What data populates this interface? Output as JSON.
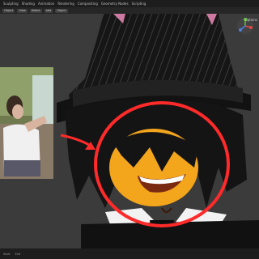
{
  "app": {
    "workspace_tabs": [
      "Sculpting",
      "Shading",
      "Animation",
      "Rendering",
      "Compositing",
      "Geometry Nodes",
      "Scripting"
    ]
  },
  "toolbar": {
    "mode_label": "Object",
    "view_label": "View",
    "select_label": "Select",
    "add_label": "Add",
    "object_label": "Object"
  },
  "viewport": {
    "options_label": "Options"
  },
  "status": {
    "start_label": "Start",
    "end_label": "End"
  },
  "colors": {
    "annotation_red": "#ff2a2a",
    "face_yellow": "#f3a51c",
    "hat_black": "#1a1a1a"
  }
}
